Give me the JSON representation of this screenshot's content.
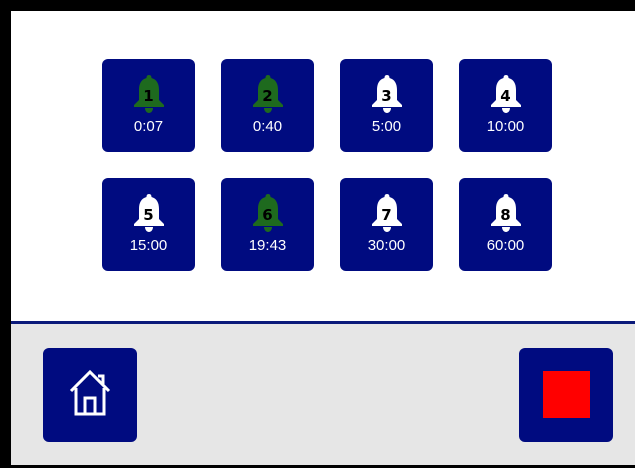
{
  "timers": [
    {
      "number": "1",
      "time": "0:07",
      "active": true
    },
    {
      "number": "2",
      "time": "0:40",
      "active": true
    },
    {
      "number": "3",
      "time": "5:00",
      "active": false
    },
    {
      "number": "4",
      "time": "10:00",
      "active": false
    },
    {
      "number": "5",
      "time": "15:00",
      "active": false
    },
    {
      "number": "6",
      "time": "19:43",
      "active": true
    },
    {
      "number": "7",
      "time": "30:00",
      "active": false
    },
    {
      "number": "8",
      "time": "60:00",
      "active": false
    }
  ],
  "colors": {
    "button_bg": "#000b80",
    "bell_active": "#1e6a1e",
    "bell_idle": "#ffffff",
    "stop": "#ff0000",
    "bottom_bar": "#e6e6e6",
    "divider": "#0b1a7a"
  },
  "icons": {
    "timer": "bell-icon",
    "home": "home-icon",
    "stop": "stop-icon"
  }
}
